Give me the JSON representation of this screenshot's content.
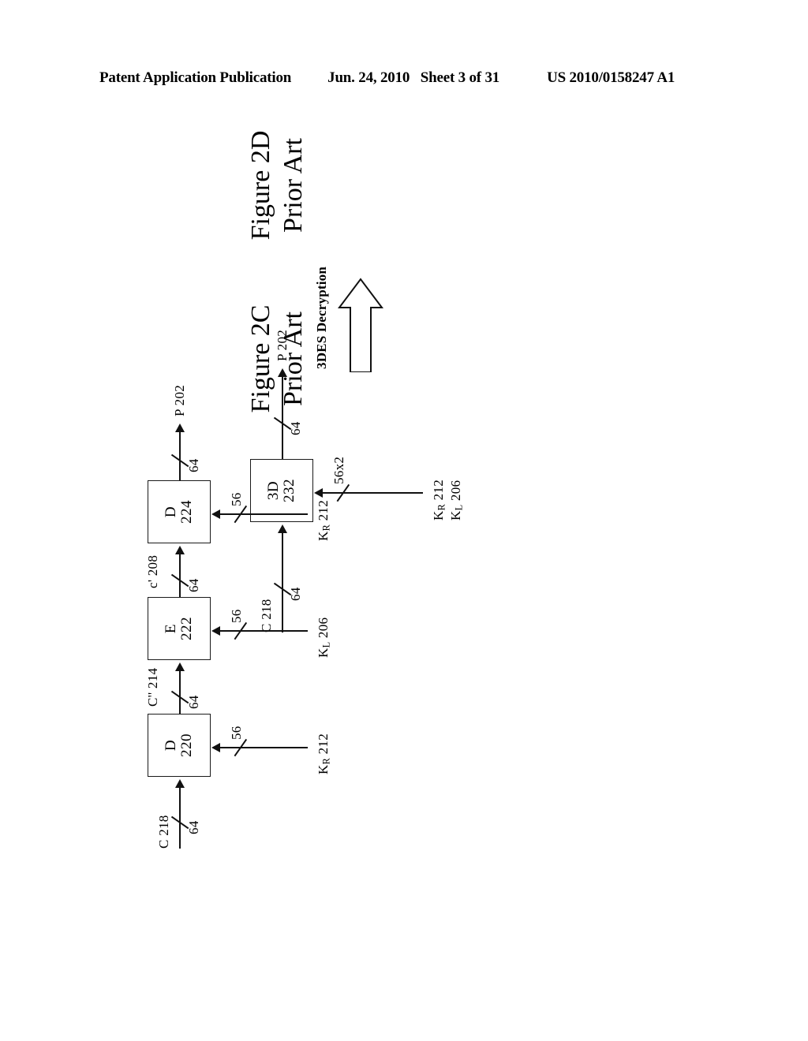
{
  "header": {
    "publication": "Patent Application Publication",
    "date": "Jun. 24, 2010",
    "sheet": "Sheet 3 of 31",
    "patent_number": "US 2010/0158247 A1"
  },
  "figures": [
    {
      "id": "fig2d",
      "caption_title": "Figure 2D",
      "caption_subtitle": "Prior Art",
      "mode_note": "3DES Decryption",
      "input": {
        "label": "C 218",
        "bits": "64"
      },
      "output": {
        "label": "P 202",
        "bits": "64"
      },
      "key_input": {
        "bits": "56x2",
        "labels": [
          "K",
          "R",
          " 212",
          "K",
          "L",
          " 206"
        ],
        "line1_base": "K",
        "line1_sub": "R",
        "line1_rest": " 212",
        "line2_base": "K",
        "line2_sub": "L",
        "line2_rest": " 206"
      },
      "blocks": [
        {
          "letter": "3D",
          "ref": "232"
        }
      ]
    },
    {
      "id": "fig2c",
      "caption_title": "Figure 2C",
      "caption_subtitle": "Prior Art",
      "input": {
        "label": "C 218",
        "bits": "64"
      },
      "output": {
        "label": "P 202",
        "bits": "64"
      },
      "intermediate": [
        {
          "label": "C'' 214",
          "bits": "64"
        },
        {
          "label": "c' 208",
          "bits": "64"
        }
      ],
      "blocks": [
        {
          "letter": "D",
          "ref": "220",
          "key_base": "K",
          "key_sub": "R",
          "key_rest": " 212",
          "key_bits": "56"
        },
        {
          "letter": "E",
          "ref": "222",
          "key_base": "K",
          "key_sub": "L",
          "key_rest": " 206",
          "key_bits": "56"
        },
        {
          "letter": "D",
          "ref": "224",
          "key_base": "K",
          "key_sub": "R",
          "key_rest": " 212",
          "key_bits": "56"
        }
      ]
    }
  ]
}
